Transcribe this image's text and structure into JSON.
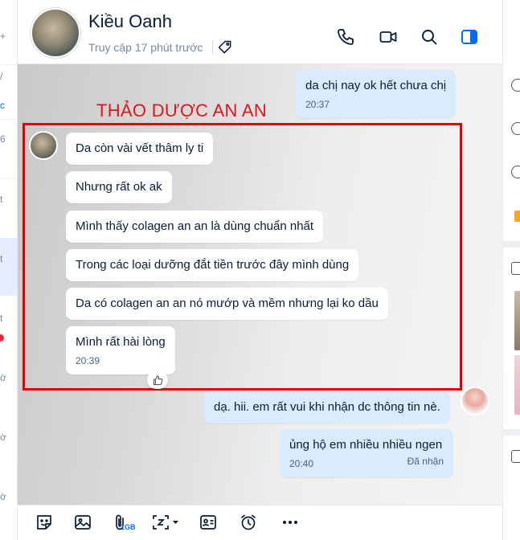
{
  "conversation": {
    "name": "Kiều Oanh",
    "last_seen": "Truy cập 17 phút trước"
  },
  "annotation": {
    "label": "THẢO DƯỢC AN AN"
  },
  "messages": [
    {
      "text": "da chị nay ok hết chưa chị",
      "time": "20:37"
    },
    {
      "text": "Da còn vài vết thâm ly ti"
    },
    {
      "text": "Nhưng rất ok ak"
    },
    {
      "text": "Mình thấy colagen an an là dùng chuẩn nhất"
    },
    {
      "text": "Trong các loại dưỡng đắt tiền trước đây mình dùng"
    },
    {
      "text": "Da có colagen an an nó mướp và mềm nhưng lại ko dầu"
    },
    {
      "text": "Mình rất hài lòng",
      "time": "20:39"
    },
    {
      "text": "dạ. hii. em rất vui khi nhận dc thông tin nè."
    },
    {
      "text": "ủng hộ em nhiều nhiều ngen",
      "time": "20:40",
      "status": "Đã nhận"
    }
  ],
  "toolbar": {
    "file_size_badge": "1GB"
  },
  "left_fragments": [
    "+",
    "/",
    "c",
    "6",
    "t",
    "t",
    "t",
    "ờ",
    "ờ",
    "ờ"
  ],
  "colors": {
    "accent": "#0068ff",
    "annotation_red": "#e00000",
    "incoming_bubble": "#ffffff",
    "outgoing_bubble": "#dbebff"
  },
  "icons": {
    "header": [
      "phone-icon",
      "video-call-icon",
      "search-icon",
      "sidebar-toggle-icon",
      "tag-icon"
    ],
    "toolbar": [
      "sticker-icon",
      "image-icon",
      "attachment-icon",
      "screenshot-icon",
      "contact-card-icon",
      "reminder-icon",
      "more-icon"
    ]
  }
}
